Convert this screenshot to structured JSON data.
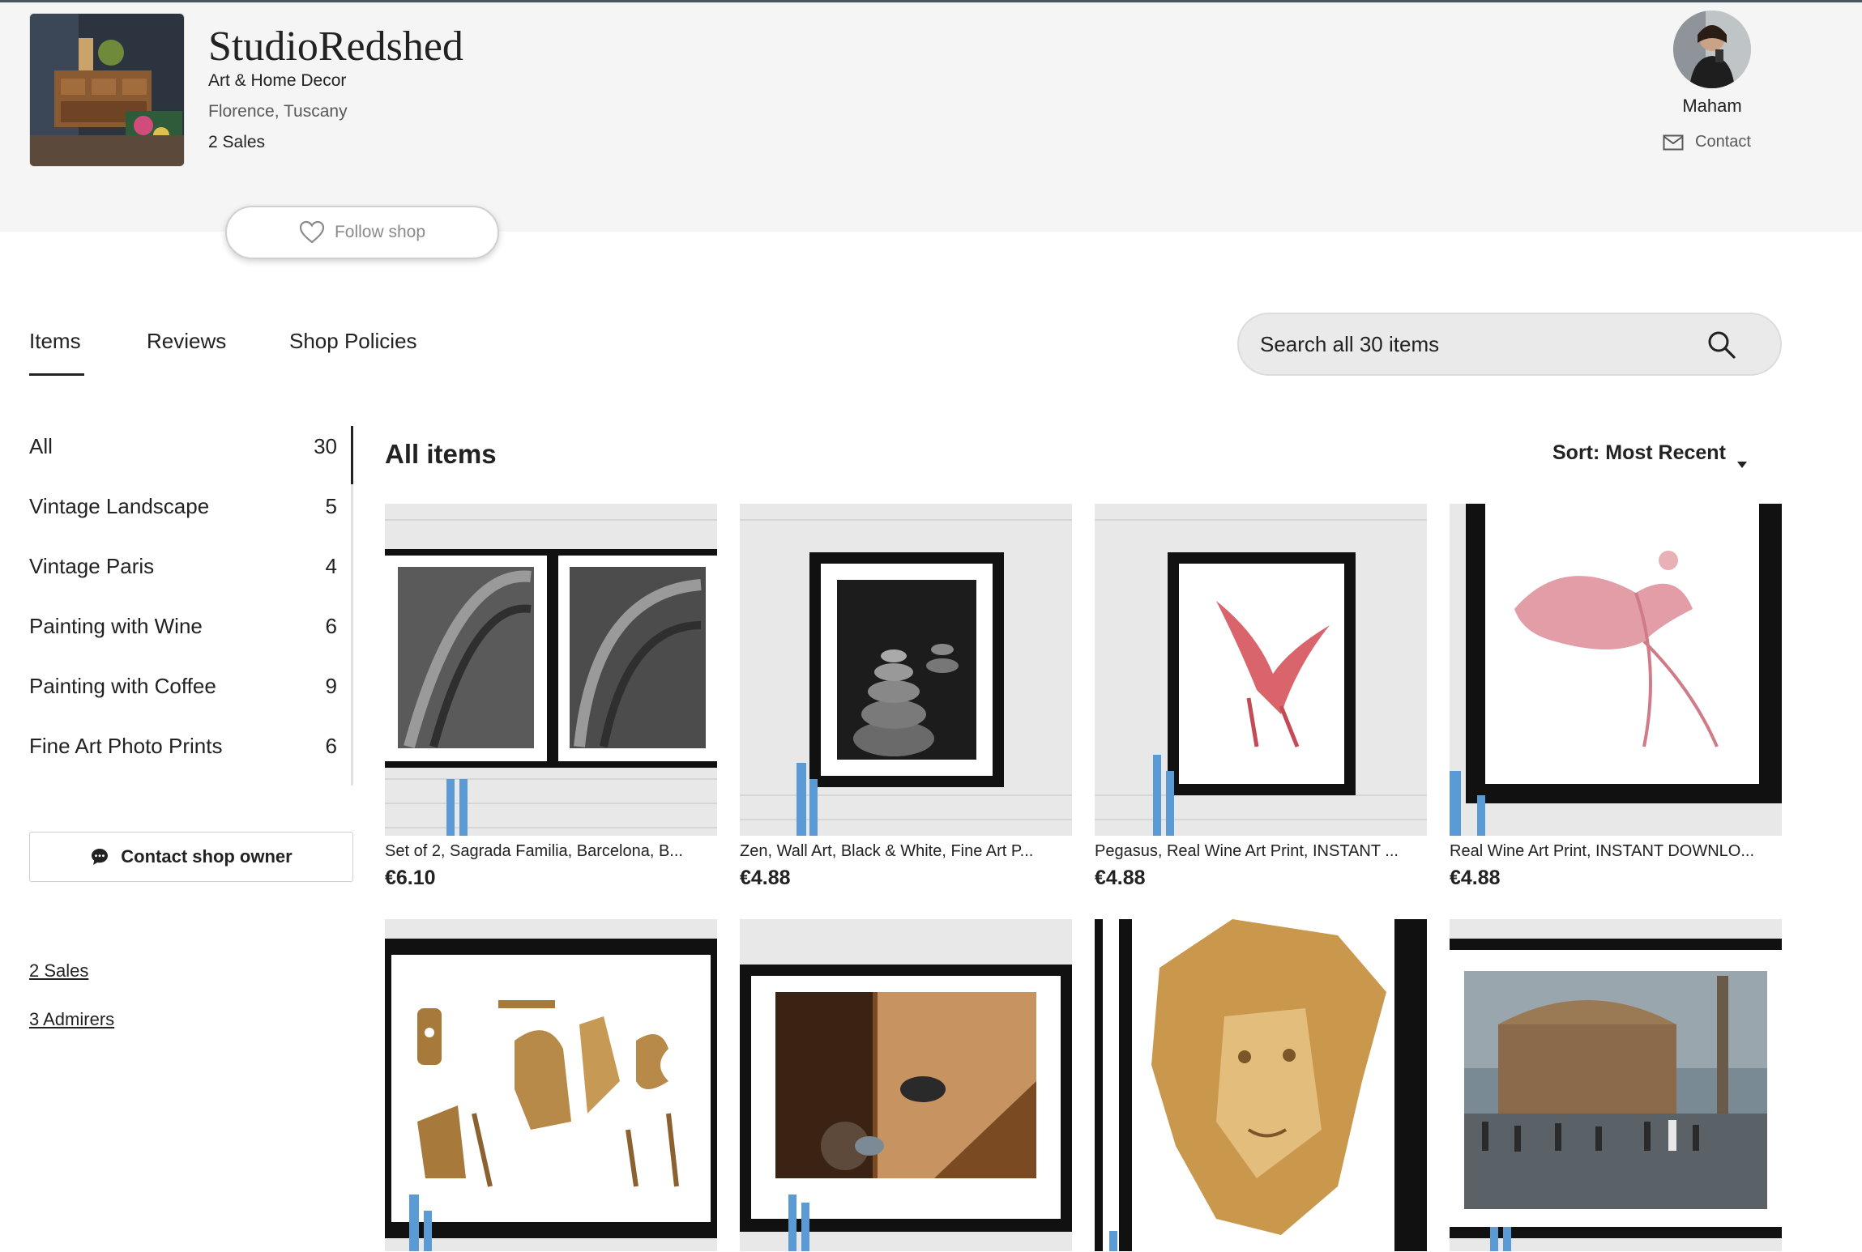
{
  "shop": {
    "name": "StudioRedshed",
    "tagline": "Art & Home Decor",
    "location": "Florence, Tuscany",
    "sales": "2 Sales",
    "follow_label": "Follow shop"
  },
  "owner": {
    "name": "Maham",
    "contact_label": "Contact"
  },
  "tabs": [
    {
      "label": "Items"
    },
    {
      "label": "Reviews"
    },
    {
      "label": "Shop Policies"
    }
  ],
  "search": {
    "placeholder": "Search all 30 items"
  },
  "sidebar": {
    "items": [
      {
        "label": "All",
        "count": "30"
      },
      {
        "label": "Vintage Landscape",
        "count": "5"
      },
      {
        "label": "Vintage Paris",
        "count": "4"
      },
      {
        "label": "Painting with Wine",
        "count": "6"
      },
      {
        "label": "Painting with Coffee",
        "count": "9"
      },
      {
        "label": "Fine Art Photo Prints",
        "count": "6"
      }
    ],
    "contact_owner_label": "Contact shop owner",
    "sales_link": "2 Sales",
    "admirers_link": "3 Admirers"
  },
  "main": {
    "title": "All items",
    "sort_label": "Sort: Most Recent",
    "listings": [
      {
        "title": "Set of 2, Sagrada Familia, Barcelona, B...",
        "price": "€6.10"
      },
      {
        "title": "Zen, Wall Art, Black & White, Fine Art P...",
        "price": "€4.88"
      },
      {
        "title": "Pegasus, Real Wine Art Print, INSTANT ...",
        "price": "€4.88"
      },
      {
        "title": "Real Wine Art Print, INSTANT DOWNLO...",
        "price": "€4.88"
      },
      {
        "title": "",
        "price": ""
      },
      {
        "title": "",
        "price": ""
      },
      {
        "title": "",
        "price": ""
      },
      {
        "title": "",
        "price": ""
      }
    ]
  },
  "colors": {
    "header_bg": "#f5f5f5",
    "text": "#222222",
    "muted": "#595959",
    "vase_blue": "#5b9bd5"
  }
}
